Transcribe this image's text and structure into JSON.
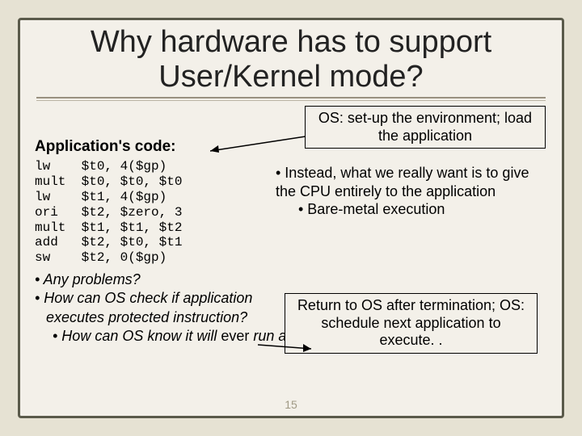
{
  "title": "Why hardware has to support User/Kernel mode?",
  "appcode_label": "Application's code:",
  "osbox": "OS: set-up the environment; load the application",
  "code": "lw    $t0, 4($gp)\nmult  $t0, $t0, $t0\nlw    $t1, 4($gp)\nori   $t2, $zero, 3\nmult  $t1, $t1, $t2\nadd   $t2, $t0, $t1\nsw    $t2, 0($gp)",
  "right1": "• Instead, what we really want is to give the CPU entirely to the application",
  "right2": "• Bare-metal execution",
  "low1": "• Any problems?",
  "low2_a": "• How can OS check if application",
  "low2_b": "executes protected instruction?",
  "low3": "• How can OS know it will ",
  "low3_ever": "ever",
  "low3_b": " run again?",
  "retbox": "Return to OS after termination; OS: schedule next application to execute. .",
  "pagenum": "15"
}
